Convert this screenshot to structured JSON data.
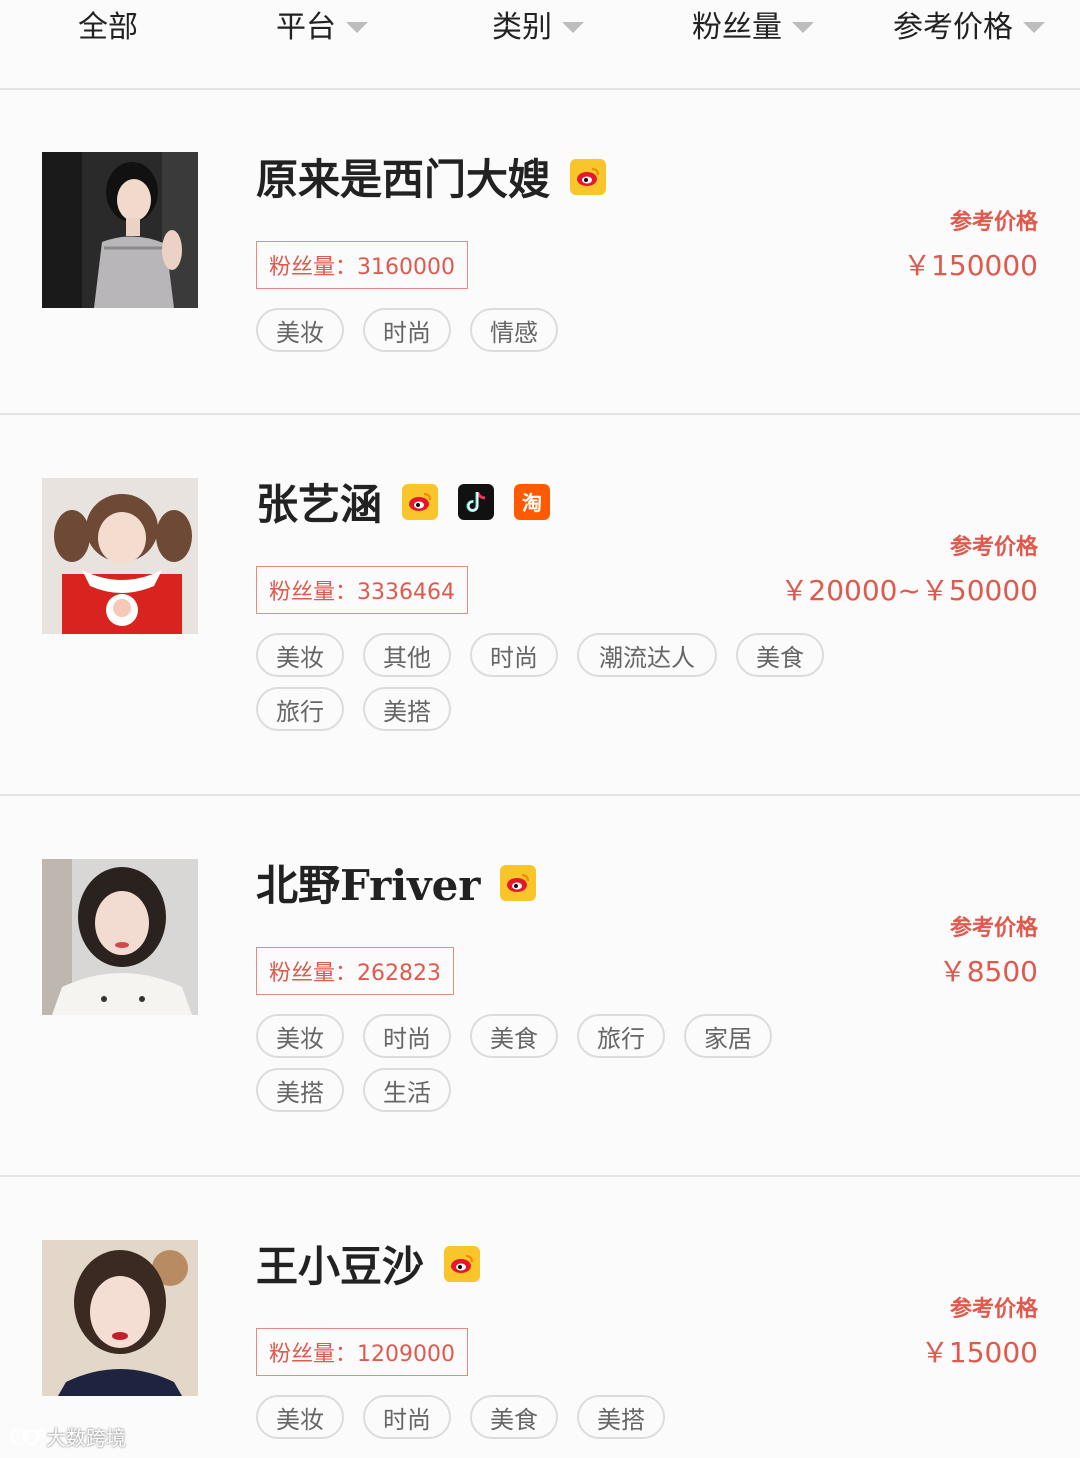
{
  "filters": {
    "all": "全部",
    "platform": "平台",
    "category": "类别",
    "fans": "粉丝量",
    "price": "参考价格"
  },
  "colors": {
    "accent": "#e0594d",
    "weibo": "#f8c52b",
    "douyin": "#111111",
    "taobao": "#ff5a00"
  },
  "cards": [
    {
      "name": "原来是西门大嫂",
      "platforms": [
        "weibo-icon"
      ],
      "fans": "粉丝量：3160000",
      "price_label": "参考价格",
      "price": "￥150000",
      "tags": [
        "美妆",
        "时尚",
        "情感"
      ]
    },
    {
      "name": "张艺涵",
      "platforms": [
        "weibo-icon",
        "douyin-icon",
        "taobao-icon"
      ],
      "taobao_glyph": "淘",
      "fans": "粉丝量：3336464",
      "price_label": "参考价格",
      "price": "￥20000~￥50000",
      "tags": [
        "美妆",
        "其他",
        "时尚",
        "潮流达人",
        "美食",
        "旅行",
        "美搭"
      ]
    },
    {
      "name": "北野Friver",
      "platforms": [
        "weibo-icon"
      ],
      "fans": "粉丝量：262823",
      "price_label": "参考价格",
      "price": "￥8500",
      "tags": [
        "美妆",
        "时尚",
        "美食",
        "旅行",
        "家居",
        "美搭",
        "生活"
      ]
    },
    {
      "name": "王小豆沙",
      "platforms": [
        "weibo-icon"
      ],
      "fans": "粉丝量：1209000",
      "price_label": "参考价格",
      "price": "￥15000",
      "tags": [
        "美妆",
        "时尚",
        "美食",
        "美搭"
      ]
    }
  ],
  "watermark": "大数跨境"
}
